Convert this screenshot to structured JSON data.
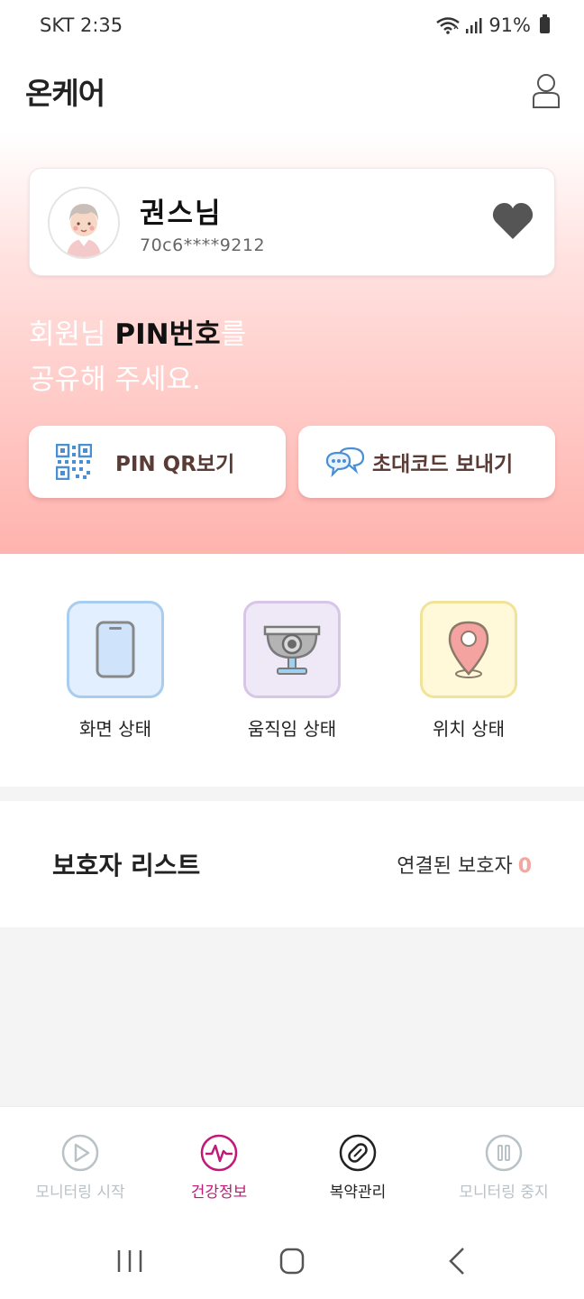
{
  "status_bar": {
    "carrier_time": "SKT 2:35",
    "battery": "91%",
    "icons": [
      "wifi-icon",
      "signal-icon",
      "battery-icon"
    ]
  },
  "header": {
    "title": "온케어",
    "profile_icon": "person-outline-icon"
  },
  "user_card": {
    "name": "권스님",
    "id": "70c6****9212",
    "heart_icon": "heart-icon"
  },
  "pin_message": {
    "line1_pre": "회원님 ",
    "line1_strong": "PIN번호",
    "line1_post": "를",
    "line2": "공유해 주세요."
  },
  "actions": {
    "qr": {
      "label": "PIN QR보기",
      "icon": "qr-code-icon"
    },
    "invite": {
      "label": "초대코드 보내기",
      "icon": "chat-bubbles-icon"
    }
  },
  "status_tiles": [
    {
      "label": "화면 상태",
      "icon": "phone-icon"
    },
    {
      "label": "움직임 상태",
      "icon": "camera-icon"
    },
    {
      "label": "위치 상태",
      "icon": "location-pin-icon"
    }
  ],
  "guardian": {
    "title": "보호자 리스트",
    "count_label": "연결된 보호자",
    "count": "0"
  },
  "bottom_nav": [
    {
      "label": "모니터링 시작",
      "icon": "play-circle-icon",
      "state": "disabled"
    },
    {
      "label": "건강정보",
      "icon": "heartbeat-circle-icon",
      "state": "active"
    },
    {
      "label": "복약관리",
      "icon": "pill-circle-icon",
      "state": "normal"
    },
    {
      "label": "모니터링 중지",
      "icon": "pause-circle-icon",
      "state": "disabled"
    }
  ],
  "colors": {
    "accent_pink": "#c2187a",
    "count_pink": "#f3a7a1",
    "hero_gradient_end": "#ffb3ae",
    "disabled_gray": "#b8c2c7"
  }
}
